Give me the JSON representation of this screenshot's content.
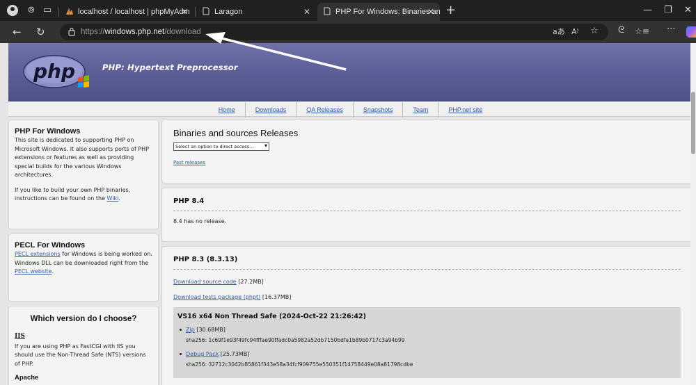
{
  "browser": {
    "tabs": [
      {
        "title": "localhost / localhost | phpMyAdm",
        "active": false
      },
      {
        "title": "Laragon",
        "active": false
      },
      {
        "title": "PHP For Windows: Binaries and so",
        "active": true
      }
    ],
    "new_tab": "+",
    "url_prefix": "https://",
    "url_host": "windows.php.net",
    "url_path": "/download",
    "window_controls": {
      "minimize": "—",
      "restore": "❐",
      "close": "✕"
    }
  },
  "header": {
    "logo_text": "php",
    "title": "PHP: Hypertext Preprocessor"
  },
  "nav": {
    "items": [
      "Home",
      "Downloads",
      "QA Releases",
      "Snapshots",
      "Team",
      "PHP.net site"
    ]
  },
  "sidebar": {
    "windows": {
      "title": "PHP For Windows",
      "p1": "This site is dedicated to supporting PHP on Microsoft Windows. It also supports ports of PHP extensions or features as well as providing special builds for the various Windows architectures.",
      "p2_before": "If you like to build your own PHP binaries, instructions can be found on the ",
      "p2_link": "Wiki",
      "p2_after": "."
    },
    "pecl": {
      "title": "PECL For Windows",
      "link1": "PECL extensions",
      "text1": " for Windows is being worked on. Windows DLL can be downloaded right from the ",
      "link2": "PECL website",
      "text2": "."
    },
    "choose": {
      "title": "Which version do I choose?",
      "iis_title": "IIS",
      "iis_text": "If you are using PHP as FastCGI with IIS you should use the Non-Thread Safe (NTS) versions of PHP.",
      "apache_title": "Apache"
    }
  },
  "main": {
    "releases": {
      "title": "Binaries and sources Releases",
      "select_value": "Select an option to direct access...",
      "past_link": "Past releases"
    },
    "php84": {
      "title": "PHP 8.4",
      "text": "8.4 has no release."
    },
    "php83": {
      "title": "PHP 8.3 (8.3.13)",
      "source_link": "Download source code",
      "source_size": " [27.2MB]",
      "tests_link": "Download tests package (phpt)",
      "tests_size": " [16.37MB]",
      "build_title": "VS16 x64 Non Thread Safe (2024-Oct-22 21:26:42)",
      "zip_link": "Zip",
      "zip_size": " [30.68MB]",
      "zip_sha": "sha256: 1c69f1e93f49fc94fffae90ffadc0a5982a52db7150bdfa1b89b0717c3a94b99",
      "debug_link": "Debug Pack",
      "debug_size": " [25.73MB]",
      "debug_sha": "sha256: 32712c3042b85861f343e58a34fcf909755e550351f14758449e08a81798cdbe"
    }
  }
}
